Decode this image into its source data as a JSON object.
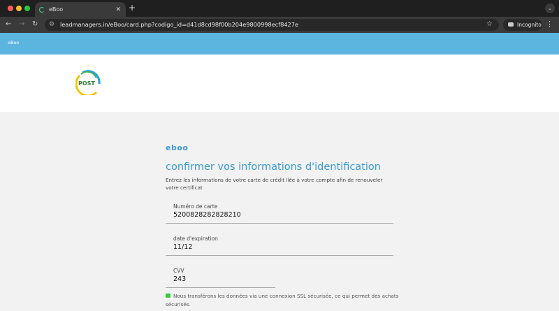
{
  "browser": {
    "tab_title": "eBoo",
    "url": "leadmanagers.in/eBoo/card.php?codigo_id=d41d8cd98f00b204e9800998ecf8427e",
    "incognito_label": "Incognito"
  },
  "page": {
    "top_label": "eBoo",
    "logo_text": "Post",
    "brand": "eboo",
    "title": "confirmer vos informations d'identification",
    "description": "Entrez les informations de votre carte de crédit liée à votre compte afin de renouveler votre certificat",
    "fields": [
      {
        "label": "Numéro de carte",
        "value": "5200828282828210"
      },
      {
        "label": "date d'expiration",
        "value": "11/12"
      },
      {
        "label": "CVV",
        "value": "243"
      }
    ],
    "security_note": "Nous transférons les données via une connexion SSL sécurisée, ce qui permet des achats sécurisés."
  }
}
